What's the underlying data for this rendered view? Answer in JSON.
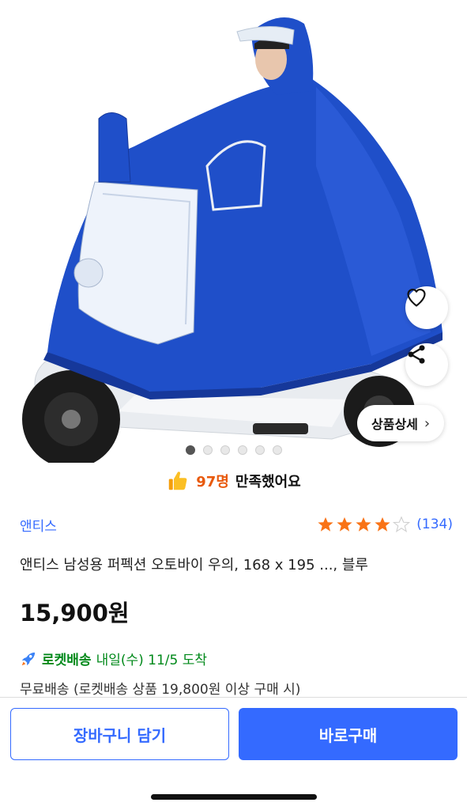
{
  "product_image": {
    "alt": "남성용 퍼펙션 오토바이 우의 블루",
    "colors": {
      "raincoat": "#1f4fc9",
      "raincoat_dark": "#16389a",
      "scooter": "#e9ecf0",
      "tire": "#1b1b1b"
    }
  },
  "gallery": {
    "total": 6,
    "active": 0,
    "detail_button_label": "상품상세",
    "detail_chevron": "›"
  },
  "satisfaction": {
    "count_text": "97명",
    "suffix": "만족했어요",
    "icon": "thumbs-up-icon"
  },
  "brand": {
    "name": "앤티스"
  },
  "rating": {
    "stars": 4,
    "max": 5,
    "count_text": "(134)",
    "color": "#f97316"
  },
  "product": {
    "title": "앤티스 남성용 퍼펙션 오토바이 우의, 168 x 195 ..., 블루",
    "price": "15,900원"
  },
  "delivery": {
    "badge": "로켓배송",
    "date_text": "내일(수) 11/5 도착",
    "shipping_text": "무료배송 (로켓배송 상품 19,800원 이상 구매 시)"
  },
  "actions": {
    "cart_label": "장바구니 담기",
    "buy_label": "바로구매"
  },
  "theme": {
    "accent": "#346aff",
    "rocket_green": "#00891a"
  }
}
